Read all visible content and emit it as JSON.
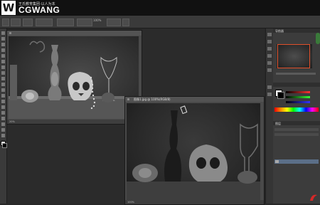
{
  "logo": {
    "mark": "W",
    "main": "CGWANG",
    "sub": "王氏教育集团·以人为本"
  },
  "options_bar": {
    "zoom": "100%"
  },
  "documents": [
    {
      "tab": "",
      "status": "20%"
    },
    {
      "tab": "图像1.jpg @ 100%(RGB/8)",
      "status": "100%"
    }
  ],
  "panels": {
    "navigator_label": "导航器",
    "layers_label": "图层"
  },
  "colors": {
    "accent": "#e0502b",
    "bg": "#282828"
  }
}
